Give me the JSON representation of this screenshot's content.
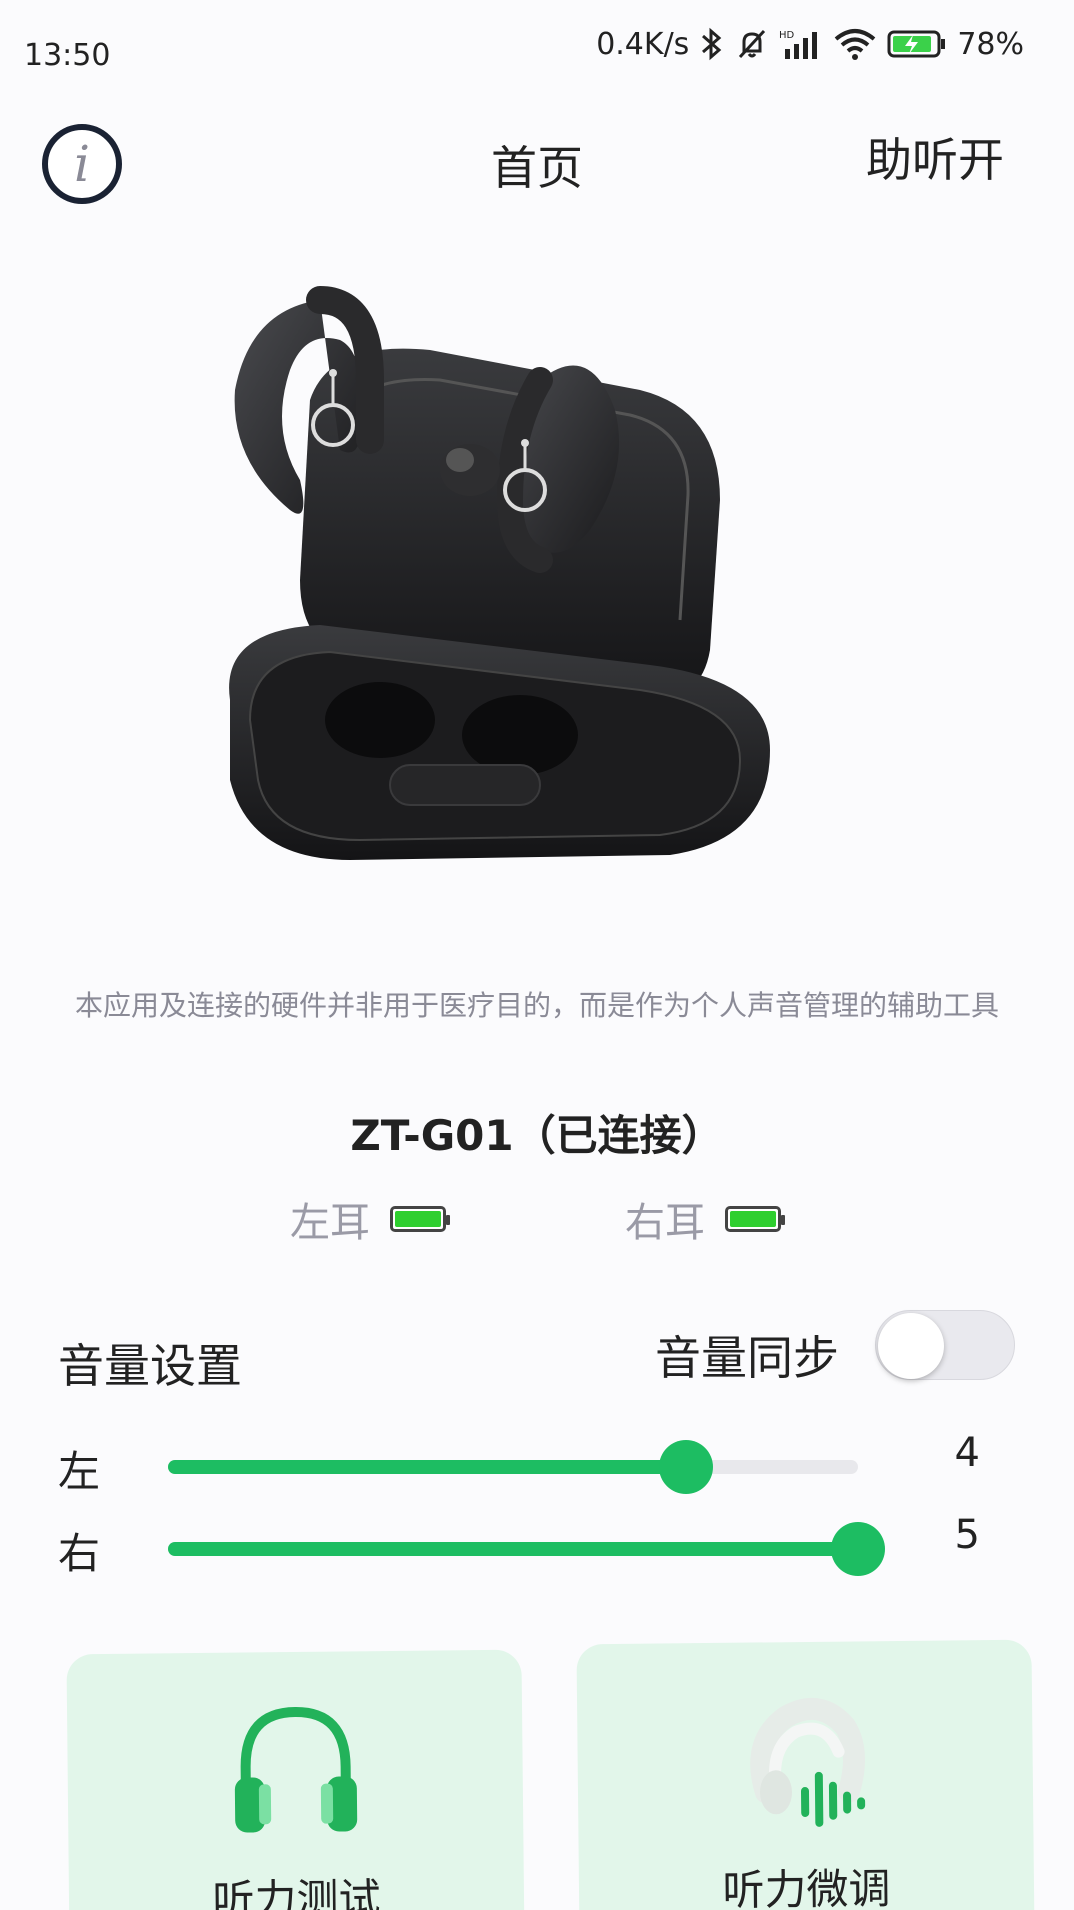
{
  "status_bar": {
    "time": "13:50",
    "net_speed": "0.4K/s",
    "battery_percent": "78%"
  },
  "header": {
    "info_icon": "info-icon",
    "title": "首页",
    "hearing_aid_toggle": "助听开"
  },
  "product": {
    "image": "earbuds-with-case"
  },
  "disclaimer": "本应用及连接的硬件并非用于医疗目的，而是作为个人声音管理的辅助工具",
  "device": {
    "name": "ZT-G01（已连接）",
    "left_ear_label": "左耳",
    "right_ear_label": "右耳",
    "left_battery_level": 1.0,
    "right_battery_level": 1.0,
    "battery_color": "#2fcf2f"
  },
  "volume": {
    "title": "音量设置",
    "sync_label": "音量同步",
    "sync_on": false,
    "left": {
      "label": "左",
      "value": "4",
      "fraction": 0.75
    },
    "right": {
      "label": "右",
      "value": "5",
      "fraction": 1.0
    },
    "accent_color": "#1dbd62"
  },
  "cards": [
    {
      "label": "听力测试",
      "icon": "headphones-icon"
    },
    {
      "label": "听力微调",
      "icon": "sound-wave-icon"
    }
  ]
}
